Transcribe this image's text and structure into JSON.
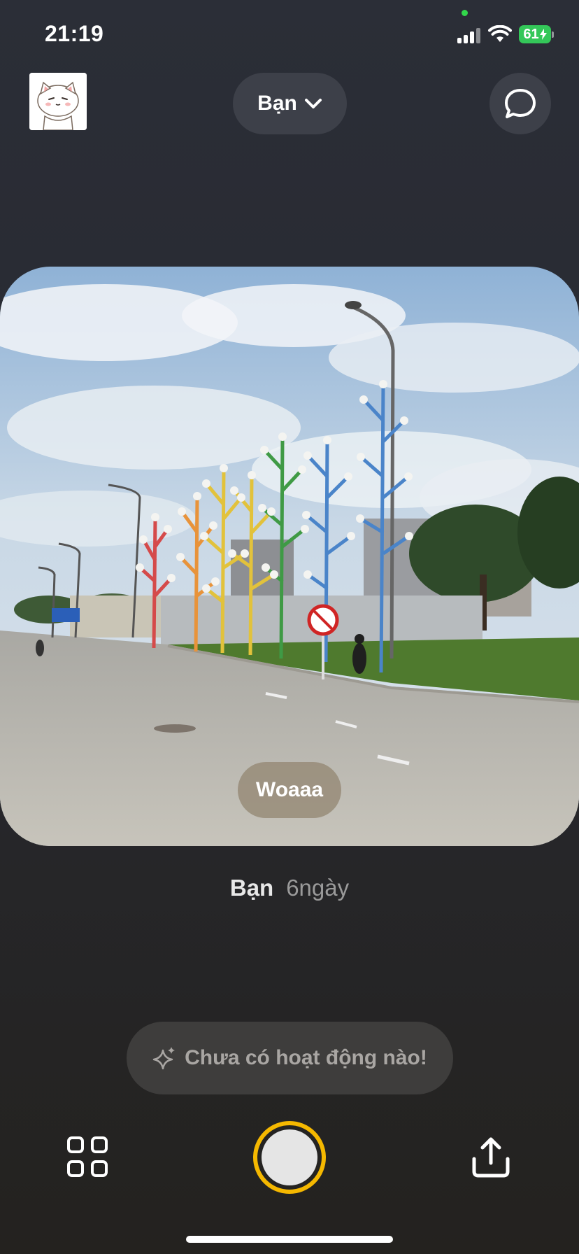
{
  "status_bar": {
    "time": "21:19",
    "battery_level": "61",
    "battery_icon": "battery-charging-icon"
  },
  "header": {
    "friend_filter_label": "Bạn",
    "chevron_icon": "chevron-down-icon",
    "chat_icon": "chat-bubble-icon"
  },
  "post": {
    "caption": "Woaaa",
    "author": "Bạn",
    "age": "6ngày"
  },
  "activity": {
    "icon": "sparkle-icon",
    "text": "Chưa có hoạt động nào!"
  },
  "toolbar": {
    "grid_icon": "grid-icon",
    "shutter_icon": "shutter-button",
    "share_icon": "share-icon"
  },
  "colors": {
    "shutter_ring": "#f5b800",
    "battery": "#34c759",
    "camera_indicator": "#32d74b"
  }
}
